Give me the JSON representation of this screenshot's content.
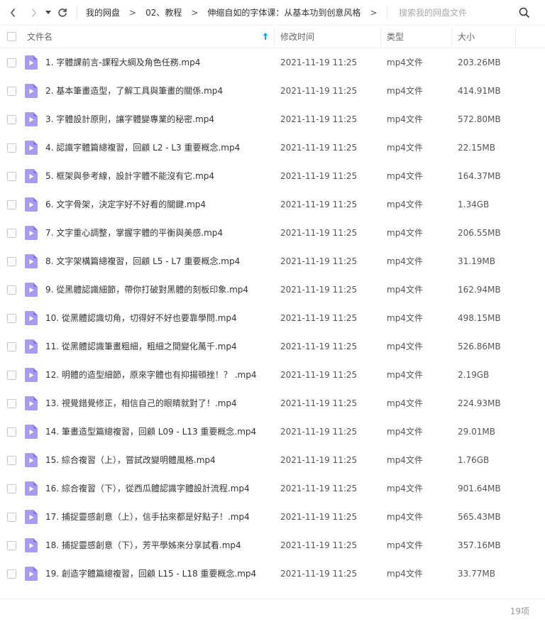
{
  "nav": {
    "breadcrumbs": [
      "我的网盘",
      "02、教程",
      "伸缩自如的字体课：从基本功到创意风格"
    ],
    "separator": ">",
    "search_placeholder": "搜索我的网盘文件"
  },
  "columns": {
    "name": "文件名",
    "modified": "修改时间",
    "type": "类型",
    "size": "大小"
  },
  "files": [
    {
      "name": "1. 字體課前言-課程大綱及角色任務.mp4",
      "modified": "2021-11-19 11:25",
      "type": "mp4文件",
      "size": "203.26MB"
    },
    {
      "name": "2. 基本筆畫造型，了解工具與筆畫的關係.mp4",
      "modified": "2021-11-19 11:25",
      "type": "mp4文件",
      "size": "414.91MB"
    },
    {
      "name": "3. 字體設計原則，讓字體變專業的秘密.mp4",
      "modified": "2021-11-19 11:25",
      "type": "mp4文件",
      "size": "572.80MB"
    },
    {
      "name": "4. 認識字體篇總複習，回顧 L2 - L3 重要概念.mp4",
      "modified": "2021-11-19 11:25",
      "type": "mp4文件",
      "size": "22.15MB"
    },
    {
      "name": "5. 框架與參考線，設計字體不能沒有它.mp4",
      "modified": "2021-11-19 11:25",
      "type": "mp4文件",
      "size": "164.37MB"
    },
    {
      "name": "6. 文字骨架，決定字好不好看的關鍵.mp4",
      "modified": "2021-11-19 11:25",
      "type": "mp4文件",
      "size": "1.34GB"
    },
    {
      "name": "7. 文字重心調整，掌握字體的平衡與美感.mp4",
      "modified": "2021-11-19 11:25",
      "type": "mp4文件",
      "size": "206.55MB"
    },
    {
      "name": "8. 文字架構篇總複習，回顧 L5 - L7 重要概念.mp4",
      "modified": "2021-11-19 11:25",
      "type": "mp4文件",
      "size": "31.19MB"
    },
    {
      "name": "9. 從黑體認識細節，帶你打破對黑體的刻板印象.mp4",
      "modified": "2021-11-19 11:25",
      "type": "mp4文件",
      "size": "162.94MB"
    },
    {
      "name": "10. 從黑體認識切角，切得好不好也要靠學問.mp4",
      "modified": "2021-11-19 11:25",
      "type": "mp4文件",
      "size": "498.15MB"
    },
    {
      "name": "11. 從黑體認識筆畫粗細，粗細之間變化萬千.mp4",
      "modified": "2021-11-19 11:25",
      "type": "mp4文件",
      "size": "526.86MB"
    },
    {
      "name": "12. 明體的造型細節，原來字體也有抑揚頓挫！？ .mp4",
      "modified": "2021-11-19 11:25",
      "type": "mp4文件",
      "size": "2.19GB"
    },
    {
      "name": "13. 視覺錯覺修正，相信自己的眼睛就對了！.mp4",
      "modified": "2021-11-19 11:25",
      "type": "mp4文件",
      "size": "224.93MB"
    },
    {
      "name": "14. 筆畫造型篇總複習，回顧 L09 - L13 重要概念.mp4",
      "modified": "2021-11-19 11:25",
      "type": "mp4文件",
      "size": "29.01MB"
    },
    {
      "name": "15. 綜合複習（上），嘗試改變明體風格.mp4",
      "modified": "2021-11-19 11:25",
      "type": "mp4文件",
      "size": "1.76GB"
    },
    {
      "name": "16. 綜合複習（下），從西瓜體認識字體設計流程.mp4",
      "modified": "2021-11-19 11:25",
      "type": "mp4文件",
      "size": "901.64MB"
    },
    {
      "name": "17. 捕捉靈感創意（上），信手拈來都是好點子！.mp4",
      "modified": "2021-11-19 11:25",
      "type": "mp4文件",
      "size": "565.43MB"
    },
    {
      "name": "18. 捕捉靈感創意（下），芳平學姊來分享試看.mp4",
      "modified": "2021-11-19 11:25",
      "type": "mp4文件",
      "size": "357.16MB"
    },
    {
      "name": "19. 創造字體篇總複習，回顧 L15 - L18 重要概念.mp4",
      "modified": "2021-11-19 11:25",
      "type": "mp4文件",
      "size": "33.77MB"
    }
  ],
  "footer": {
    "count": "19项"
  },
  "colors": {
    "file_icon": "#a99cf0",
    "file_icon_fold": "#8677e6",
    "accent": "#06a7ff"
  },
  "icons": {
    "back": "chevron-left-icon",
    "forward": "chevron-right-icon",
    "dropdown": "caret-down-icon",
    "refresh": "refresh-icon",
    "search": "search-icon",
    "sort": "sort-up-arrow-icon",
    "file": "video-file-icon"
  }
}
